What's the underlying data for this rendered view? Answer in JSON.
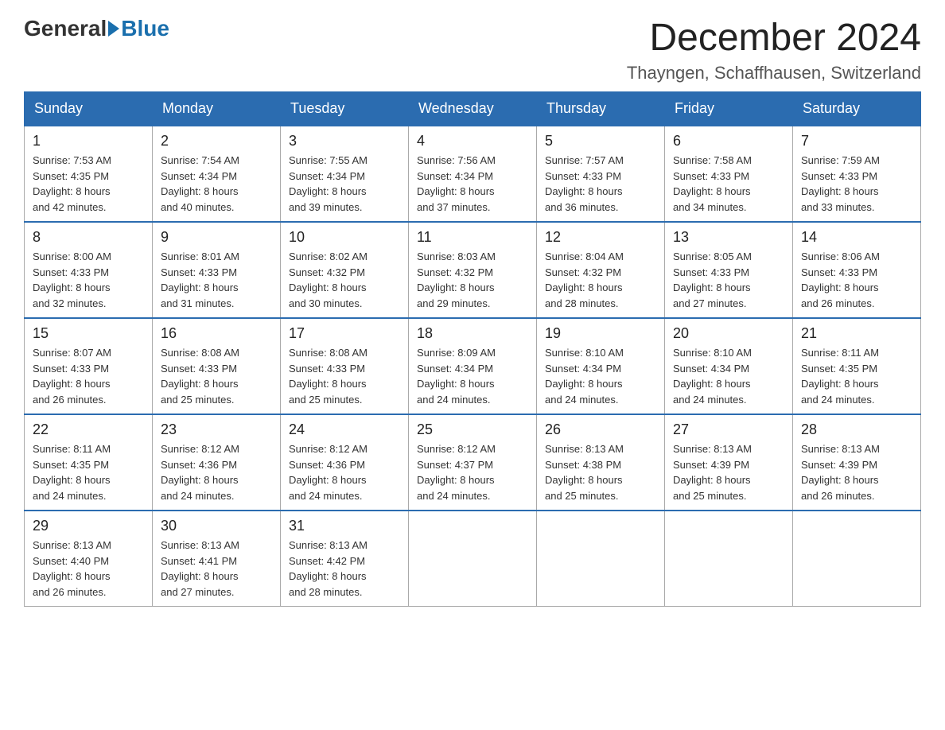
{
  "header": {
    "logo_general": "General",
    "logo_blue": "Blue",
    "title": "December 2024",
    "subtitle": "Thayngen, Schaffhausen, Switzerland"
  },
  "weekdays": [
    "Sunday",
    "Monday",
    "Tuesday",
    "Wednesday",
    "Thursday",
    "Friday",
    "Saturday"
  ],
  "weeks": [
    [
      {
        "day": "1",
        "sunrise": "7:53 AM",
        "sunset": "4:35 PM",
        "daylight": "8 hours and 42 minutes."
      },
      {
        "day": "2",
        "sunrise": "7:54 AM",
        "sunset": "4:34 PM",
        "daylight": "8 hours and 40 minutes."
      },
      {
        "day": "3",
        "sunrise": "7:55 AM",
        "sunset": "4:34 PM",
        "daylight": "8 hours and 39 minutes."
      },
      {
        "day": "4",
        "sunrise": "7:56 AM",
        "sunset": "4:34 PM",
        "daylight": "8 hours and 37 minutes."
      },
      {
        "day": "5",
        "sunrise": "7:57 AM",
        "sunset": "4:33 PM",
        "daylight": "8 hours and 36 minutes."
      },
      {
        "day": "6",
        "sunrise": "7:58 AM",
        "sunset": "4:33 PM",
        "daylight": "8 hours and 34 minutes."
      },
      {
        "day": "7",
        "sunrise": "7:59 AM",
        "sunset": "4:33 PM",
        "daylight": "8 hours and 33 minutes."
      }
    ],
    [
      {
        "day": "8",
        "sunrise": "8:00 AM",
        "sunset": "4:33 PM",
        "daylight": "8 hours and 32 minutes."
      },
      {
        "day": "9",
        "sunrise": "8:01 AM",
        "sunset": "4:33 PM",
        "daylight": "8 hours and 31 minutes."
      },
      {
        "day": "10",
        "sunrise": "8:02 AM",
        "sunset": "4:32 PM",
        "daylight": "8 hours and 30 minutes."
      },
      {
        "day": "11",
        "sunrise": "8:03 AM",
        "sunset": "4:32 PM",
        "daylight": "8 hours and 29 minutes."
      },
      {
        "day": "12",
        "sunrise": "8:04 AM",
        "sunset": "4:32 PM",
        "daylight": "8 hours and 28 minutes."
      },
      {
        "day": "13",
        "sunrise": "8:05 AM",
        "sunset": "4:33 PM",
        "daylight": "8 hours and 27 minutes."
      },
      {
        "day": "14",
        "sunrise": "8:06 AM",
        "sunset": "4:33 PM",
        "daylight": "8 hours and 26 minutes."
      }
    ],
    [
      {
        "day": "15",
        "sunrise": "8:07 AM",
        "sunset": "4:33 PM",
        "daylight": "8 hours and 26 minutes."
      },
      {
        "day": "16",
        "sunrise": "8:08 AM",
        "sunset": "4:33 PM",
        "daylight": "8 hours and 25 minutes."
      },
      {
        "day": "17",
        "sunrise": "8:08 AM",
        "sunset": "4:33 PM",
        "daylight": "8 hours and 25 minutes."
      },
      {
        "day": "18",
        "sunrise": "8:09 AM",
        "sunset": "4:34 PM",
        "daylight": "8 hours and 24 minutes."
      },
      {
        "day": "19",
        "sunrise": "8:10 AM",
        "sunset": "4:34 PM",
        "daylight": "8 hours and 24 minutes."
      },
      {
        "day": "20",
        "sunrise": "8:10 AM",
        "sunset": "4:34 PM",
        "daylight": "8 hours and 24 minutes."
      },
      {
        "day": "21",
        "sunrise": "8:11 AM",
        "sunset": "4:35 PM",
        "daylight": "8 hours and 24 minutes."
      }
    ],
    [
      {
        "day": "22",
        "sunrise": "8:11 AM",
        "sunset": "4:35 PM",
        "daylight": "8 hours and 24 minutes."
      },
      {
        "day": "23",
        "sunrise": "8:12 AM",
        "sunset": "4:36 PM",
        "daylight": "8 hours and 24 minutes."
      },
      {
        "day": "24",
        "sunrise": "8:12 AM",
        "sunset": "4:36 PM",
        "daylight": "8 hours and 24 minutes."
      },
      {
        "day": "25",
        "sunrise": "8:12 AM",
        "sunset": "4:37 PM",
        "daylight": "8 hours and 24 minutes."
      },
      {
        "day": "26",
        "sunrise": "8:13 AM",
        "sunset": "4:38 PM",
        "daylight": "8 hours and 25 minutes."
      },
      {
        "day": "27",
        "sunrise": "8:13 AM",
        "sunset": "4:39 PM",
        "daylight": "8 hours and 25 minutes."
      },
      {
        "day": "28",
        "sunrise": "8:13 AM",
        "sunset": "4:39 PM",
        "daylight": "8 hours and 26 minutes."
      }
    ],
    [
      {
        "day": "29",
        "sunrise": "8:13 AM",
        "sunset": "4:40 PM",
        "daylight": "8 hours and 26 minutes."
      },
      {
        "day": "30",
        "sunrise": "8:13 AM",
        "sunset": "4:41 PM",
        "daylight": "8 hours and 27 minutes."
      },
      {
        "day": "31",
        "sunrise": "8:13 AM",
        "sunset": "4:42 PM",
        "daylight": "8 hours and 28 minutes."
      },
      null,
      null,
      null,
      null
    ]
  ],
  "labels": {
    "sunrise": "Sunrise: ",
    "sunset": "Sunset: ",
    "daylight": "Daylight: "
  }
}
